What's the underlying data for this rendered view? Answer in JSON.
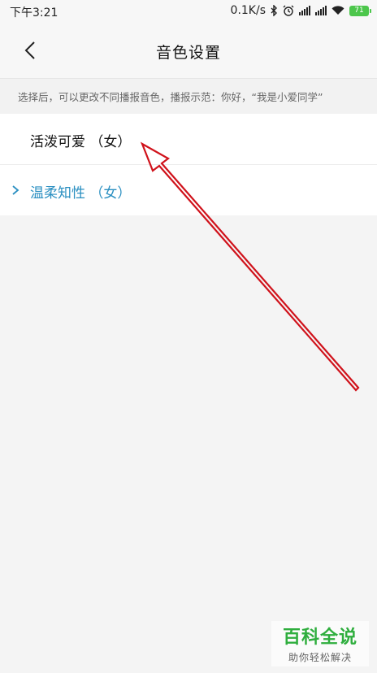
{
  "status_bar": {
    "time": "下午3:21",
    "network_speed": "0.1K/s",
    "battery": "71"
  },
  "nav": {
    "title": "音色设置"
  },
  "hint": {
    "text": "选择后，可以更改不同播报音色，播报示范：你好，“我是小爱同学”"
  },
  "voices": [
    {
      "label": "活泼可爱 （女）",
      "selected": false
    },
    {
      "label": "温柔知性 （女）",
      "selected": true
    }
  ],
  "colors": {
    "selected": "#2a8fc1",
    "annotation": "#d0121b",
    "battery": "#4cc64b",
    "watermark": "#2fae3e"
  },
  "watermark": {
    "main": "百科全说",
    "sub": "助你轻松解决"
  }
}
